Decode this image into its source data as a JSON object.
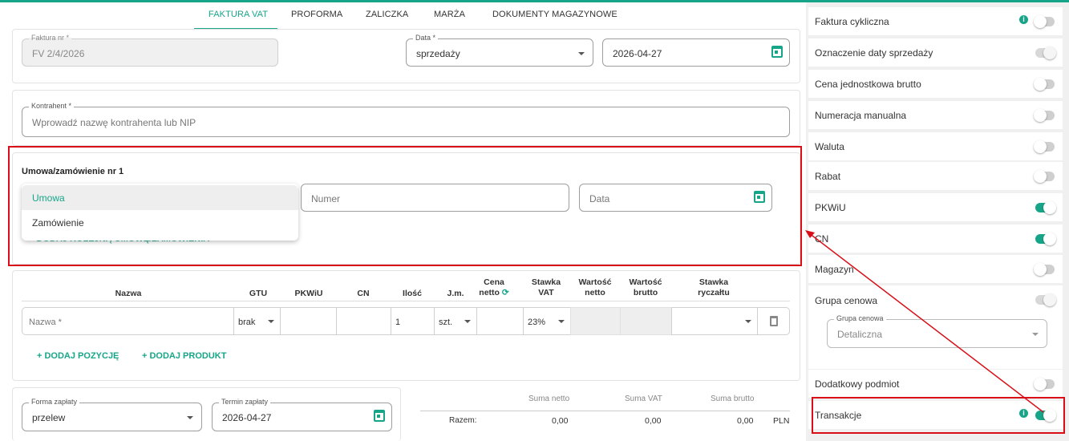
{
  "tabs": [
    "FAKTURA VAT",
    "PROFORMA",
    "ZALICZKA",
    "MARŻA",
    "DOKUMENTY MAGAZYNOWE"
  ],
  "invoice": {
    "number_label": "Faktura nr *",
    "number_value": "FV 2/4/2026",
    "date_label": "Data *",
    "date_type": "sprzedaży",
    "date_value": "2026-04-27"
  },
  "contractor": {
    "label": "Kontrahent *",
    "placeholder": "Wprowadź nazwę kontrahenta lub NIP"
  },
  "contract": {
    "title": "Umowa/zamówienie nr 1",
    "options": [
      "Umowa",
      "Zamówienie"
    ],
    "number_placeholder": "Numer",
    "date_placeholder": "Data",
    "add_link": "DODAJ KOLEJNĄ UMOWĘ/ZAMÓWIENIA"
  },
  "table": {
    "headers": {
      "name": "Nazwa",
      "gtu": "GTU",
      "pkwiu": "PKWiU",
      "cn": "CN",
      "qty": "Ilość",
      "unit": "J.m.",
      "net_price_1": "Cena",
      "net_price_2": "netto",
      "vat_rate_1": "Stawka",
      "vat_rate_2": "VAT",
      "net_value_1": "Wartość",
      "net_value_2": "netto",
      "gross_value_1": "Wartość",
      "gross_value_2": "brutto",
      "flat_rate_1": "Stawka",
      "flat_rate_2": "ryczałtu"
    },
    "row": {
      "name_placeholder": "Nazwa *",
      "gtu": "brak",
      "qty": "1",
      "unit": "szt.",
      "vat": "23%"
    },
    "add_position": "DODAJ POZYCJĘ",
    "add_product": "DODAJ PRODUKT"
  },
  "payment": {
    "form_label": "Forma zapłaty",
    "form_value": "przelew",
    "due_label": "Termin zapłaty",
    "due_value": "2026-04-27"
  },
  "summary": {
    "net_label": "Suma netto",
    "vat_label": "Suma VAT",
    "gross_label": "Suma brutto",
    "total_label": "Razem:",
    "net": "0,00",
    "vat": "0,00",
    "gross": "0,00",
    "currency": "PLN"
  },
  "options": [
    {
      "label": "Faktura cykliczna",
      "state": "off",
      "info": true
    },
    {
      "label": "Oznaczenie daty sprzedaży",
      "state": "disabled-on",
      "info": false
    },
    {
      "label": "Cena jednostkowa brutto",
      "state": "off",
      "info": false
    },
    {
      "label": "Numeracja manualna",
      "state": "off",
      "info": false
    },
    {
      "label": "Waluta",
      "state": "off",
      "info": false
    },
    {
      "label": "Rabat",
      "state": "off",
      "info": false
    },
    {
      "label": "PKWiU",
      "state": "on",
      "info": false
    },
    {
      "label": "CN",
      "state": "on",
      "info": false
    },
    {
      "label": "Magazyn",
      "state": "off",
      "info": false
    },
    {
      "label": "Grupa cenowa",
      "state": "disabled-on",
      "info": false
    },
    {
      "label": "Dodatkowy podmiot",
      "state": "off",
      "info": false
    },
    {
      "label": "Transakcje",
      "state": "on",
      "info": true
    }
  ],
  "price_group": {
    "label": "Grupa cenowa",
    "value": "Detaliczna"
  },
  "colors": {
    "accent": "#17a589",
    "annotation": "#d80f16"
  }
}
